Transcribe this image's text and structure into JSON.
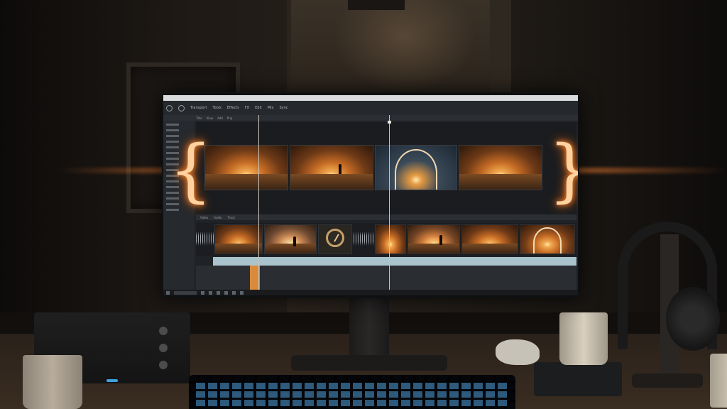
{
  "toolbar": {
    "items": [
      "Transport",
      "Tools",
      "Effects",
      "FX",
      "Edit",
      "Mix",
      "Sync"
    ]
  },
  "subbar": {
    "items": [
      "Title",
      "View",
      "Add",
      "Proj"
    ]
  },
  "timeline_header": {
    "items": [
      "Video",
      "Audio",
      "Track"
    ]
  },
  "colors": {
    "accent_glow": "#ff8a2a",
    "screen_bg": "#1f2226",
    "track_bar": "#a9c4cc",
    "marker": "#d98a3a"
  },
  "icons": [
    "play-icon",
    "scissors-icon",
    "compass-icon",
    "waveform-icon"
  ]
}
